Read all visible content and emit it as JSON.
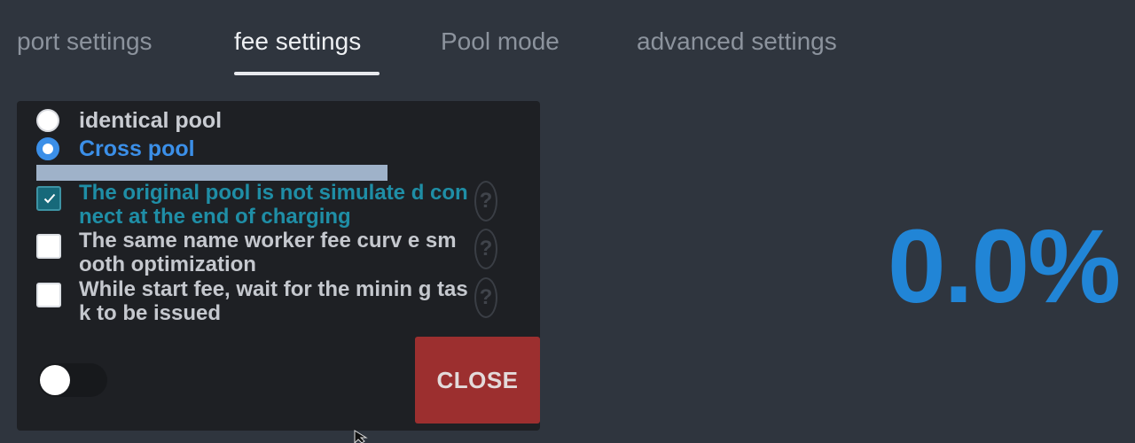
{
  "tabs": [
    {
      "label": "port settings",
      "active": false
    },
    {
      "label": "fee settings",
      "active": true
    },
    {
      "label": "Pool mode",
      "active": false
    },
    {
      "label": "advanced settings",
      "active": false
    }
  ],
  "panel": {
    "radio_options": [
      {
        "label": "identical pool",
        "checked": false
      },
      {
        "label": "Cross pool",
        "checked": true
      }
    ],
    "checkboxes": [
      {
        "label": "The original pool is not simulate d connect at the end of charging",
        "checked": true,
        "help": "?"
      },
      {
        "label": "The same name worker fee curv e smooth optimization",
        "checked": false,
        "help": "?"
      },
      {
        "label": "While start fee, wait for the minin g task to be issued",
        "checked": false,
        "help": "?"
      }
    ],
    "toggle": {
      "on": false
    },
    "close_label": "CLOSE"
  },
  "fee_percent": "0.0%",
  "colors": {
    "background": "#2f353e",
    "panel": "#1e2024",
    "accent_blue": "#3b8fe8",
    "teal": "#1f8ea6",
    "close_red": "#9c2f2f",
    "percent_blue": "#2185d6"
  }
}
